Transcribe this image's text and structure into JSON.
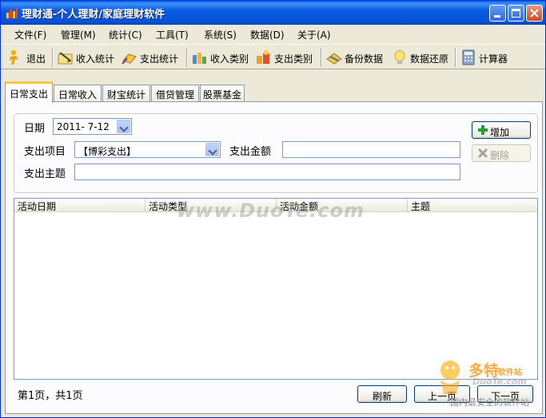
{
  "window": {
    "title": "理财通-个人理财/家庭理财软件"
  },
  "menu": {
    "items": [
      {
        "label": "文件(F)"
      },
      {
        "label": "管理(M)"
      },
      {
        "label": "统计(C)"
      },
      {
        "label": "工具(T)"
      },
      {
        "label": "系统(S)"
      },
      {
        "label": "数据(D)"
      },
      {
        "label": "关于(A)"
      }
    ]
  },
  "toolbar": {
    "items": [
      {
        "label": "退出",
        "icon": "exit-person-icon"
      },
      {
        "label": "收入统计",
        "icon": "income-stats-icon"
      },
      {
        "label": "支出统计",
        "icon": "expense-stats-icon"
      },
      {
        "label": "收入类别",
        "icon": "income-category-icon"
      },
      {
        "label": "支出类别",
        "icon": "expense-category-icon"
      },
      {
        "label": "备份数据",
        "icon": "backup-icon"
      },
      {
        "label": "数据还原",
        "icon": "restore-bulb-icon"
      },
      {
        "label": "计算器",
        "icon": "calculator-icon"
      }
    ]
  },
  "tabs": [
    {
      "label": "日常支出",
      "active": true
    },
    {
      "label": "日常收入",
      "active": false
    },
    {
      "label": "财宝统计",
      "active": false
    },
    {
      "label": "借贷管理",
      "active": false
    },
    {
      "label": "股票基金",
      "active": false
    }
  ],
  "form": {
    "date_label": "日期",
    "date_value": "2011- 7-12",
    "item_label": "支出项目",
    "item_value": "【博彩支出】",
    "amount_label": "支出金额",
    "amount_value": "",
    "subject_label": "支出主题",
    "subject_value": "",
    "add_label": "增加",
    "delete_label": "删除"
  },
  "list": {
    "columns": [
      "活动日期",
      "活动类型",
      "活动金额",
      "主题"
    ],
    "rows": []
  },
  "footer": {
    "page_info": "第1页，共1页",
    "refresh_label": "刷新",
    "prev_label": "上一页",
    "next_label": "下一页"
  },
  "watermark": {
    "main": "www.DuoTe.com",
    "logo_title": "多特",
    "logo_small": "软件站",
    "logo_url": "DuoTe.com",
    "logo_slogan": "国内最安全的软件站"
  },
  "colors": {
    "titlebar": "#0A5AE3",
    "tab_highlight": "#FFC83C",
    "add_icon": "#2E9B2E"
  }
}
